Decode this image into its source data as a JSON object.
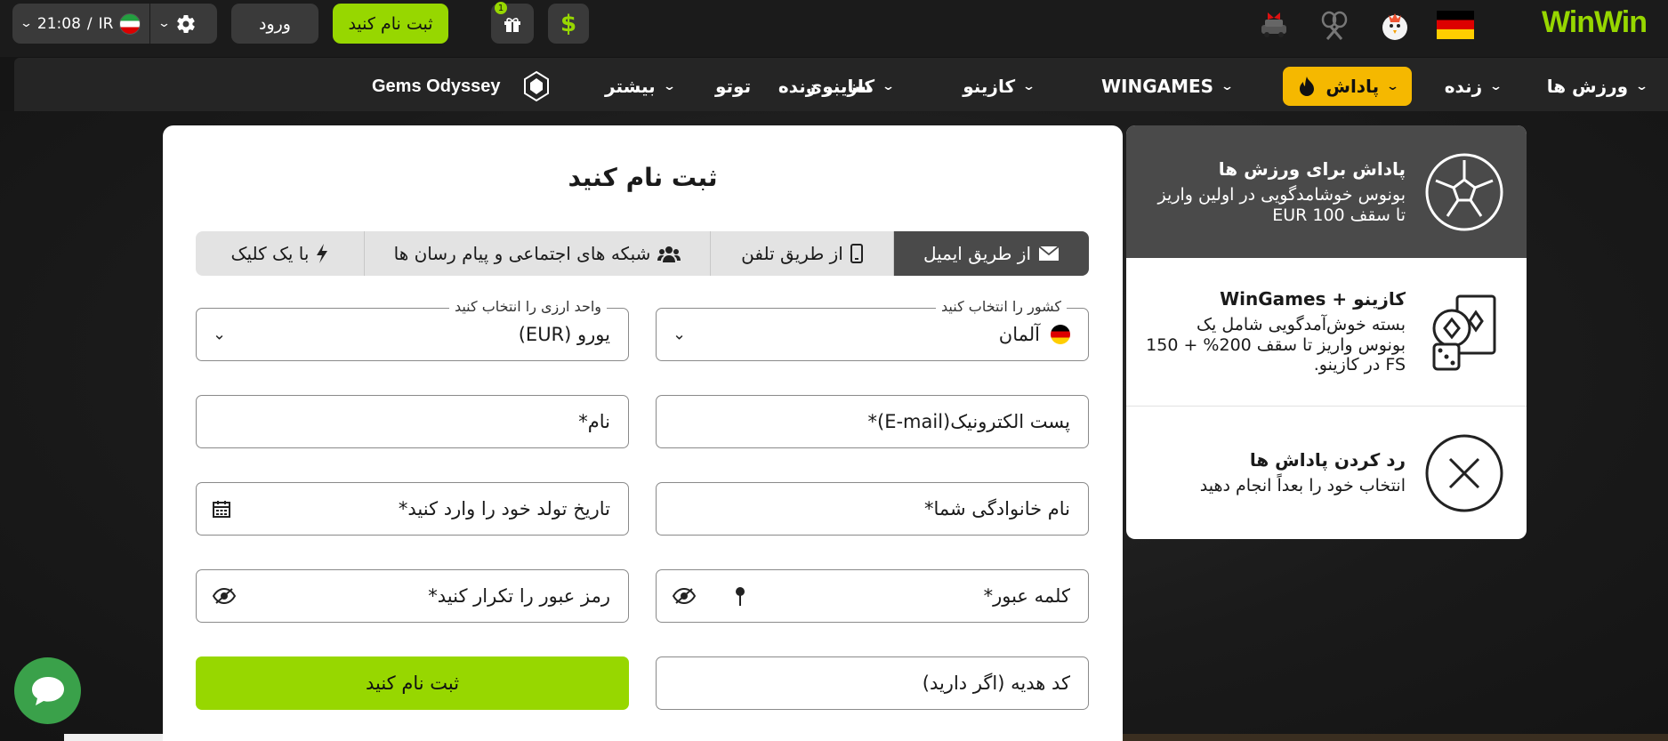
{
  "header": {
    "time": "21:08",
    "locale_sep": "/",
    "locale_code": "IR",
    "login_label": "ورود",
    "register_label": "ثبت نام کنید",
    "gift_count": "1",
    "dollar_symbol": "$",
    "brand_part1": "Win",
    "brand_part2": "Win"
  },
  "nav": {
    "items": [
      {
        "label": "ورزش ها"
      },
      {
        "label": "زنده"
      },
      {
        "label": "پاداش"
      },
      {
        "label": "WINGAMES"
      },
      {
        "label": "کازینو"
      },
      {
        "label": "کازینو زنده"
      },
      {
        "label": "سایبری"
      },
      {
        "label": "توتو"
      },
      {
        "label": "بیشتر"
      },
      {
        "label": "Gems Odyssey"
      }
    ]
  },
  "form": {
    "title": "ثبت نام کنید",
    "tabs": [
      {
        "label": "از طریق ایمیل"
      },
      {
        "label": "از طریق تلفن"
      },
      {
        "label": "شبکه های اجتماعی و پیام رسان ها"
      },
      {
        "label": "با یک کلیک"
      }
    ],
    "country_legend": "کشور را انتخاب کنید",
    "country_value": "آلمان",
    "currency_legend": "واحد ارزی را انتخاب کنید",
    "currency_value": "یورو (EUR)",
    "email_placeholder": "پست الکترونیک(E-mail)*",
    "name_placeholder": "نام*",
    "lastname_placeholder": "نام خانوادگی شما*",
    "birthdate_placeholder": "تاریخ تولد خود را وارد کنید*",
    "password_placeholder": "کلمه عبور*",
    "password_repeat_placeholder": "رمز عبور را تکرار کنید*",
    "promo_placeholder": "کد هدیه (اگر دارید)",
    "submit_label": "ثبت نام کنید"
  },
  "bonuses": [
    {
      "title": "پاداش برای ورزش ها",
      "desc": "بونوس خوشامدگویی در اولین واریز تا سقف 100 EUR",
      "icon": "soccer-ball-icon"
    },
    {
      "title": "کازینو + WinGames",
      "desc": "بسته خوش‌آمدگویی شامل یک بونوس واریز تا سقف 200% + 150 FS در کازینو.",
      "icon": "cards-dice-icon"
    },
    {
      "title": "رد کردن پاداش ها",
      "desc": "انتخاب خود را بعداً انجام دهید",
      "icon": "close-circle-icon"
    }
  ],
  "colors": {
    "accent_green": "#97d700",
    "active_orange": "#f5b800",
    "dark_panel": "#4a4a4a",
    "chat_green": "#3aa14a"
  }
}
